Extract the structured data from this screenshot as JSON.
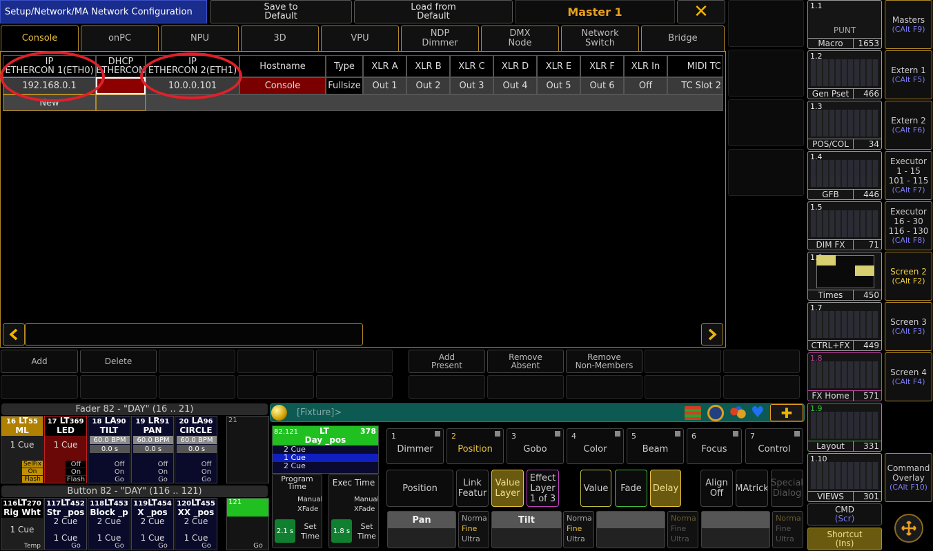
{
  "title": "Setup/Network/MA Network Configuration",
  "top": {
    "save": "Save to\nDefault",
    "load": "Load from\nDefault",
    "master": "Master 1",
    "close": "✕"
  },
  "tabs": [
    "Console",
    "onPC",
    "NPU",
    "3D",
    "VPU",
    "NDP\nDimmer",
    "DMX\nNode",
    "Network\nSwitch",
    "Bridge"
  ],
  "table": {
    "headers": [
      "IP\nETHERCON 1(ETH0)",
      "DHCP\nETHERCON",
      "IP\nETHERCON 2(ETH1)",
      "Hostname",
      "Type",
      "XLR A",
      "XLR B",
      "XLR C",
      "XLR D",
      "XLR E",
      "XLR F",
      "XLR In",
      "MIDI TC"
    ],
    "row": [
      "192.168.0.1",
      "",
      "10.0.0.101",
      "Console",
      "Fullsize",
      "Out 1",
      "Out 2",
      "Out 3",
      "Out 4",
      "Out 5",
      "Out 6",
      "Off",
      "TC Slot 2"
    ],
    "new_label": "New"
  },
  "actions": {
    "add": "Add",
    "delete": "Delete",
    "add_present": "Add\nPresent",
    "remove_absent": "Remove\nAbsent",
    "remove_non_members": "Remove\nNon-Members"
  },
  "views": [
    {
      "num": "1.1",
      "name": "Macro",
      "count": "1653",
      "label": "PUNT"
    },
    {
      "num": "1.2",
      "name": "Gen Pset",
      "count": "466"
    },
    {
      "num": "1.3",
      "name": "POS/COL",
      "count": "34"
    },
    {
      "num": "1.4",
      "name": "GFB",
      "count": "446"
    },
    {
      "num": "1.5",
      "name": "DIM FX",
      "count": "71"
    },
    {
      "num": "1.6",
      "name": "Times",
      "count": "450"
    },
    {
      "num": "1.7",
      "name": "CTRL+FX",
      "count": "449"
    },
    {
      "num": "1.8",
      "name": "FX Home",
      "count": "571"
    },
    {
      "num": "1.9",
      "name": "Layout",
      "count": "331"
    },
    {
      "num": "1.10",
      "name": "VIEWS",
      "count": "301"
    }
  ],
  "side": [
    {
      "label": "Masters",
      "key": "(CAlt F9)"
    },
    {
      "label": "Extern 1",
      "key": "(CAlt F5)"
    },
    {
      "label": "Extern 2",
      "key": "(CAlt F6)"
    },
    {
      "label": "Executor\n1 - 15\n101 - 115",
      "key": "(CAlt F7)"
    },
    {
      "label": "Executor\n16 - 30\n116 - 130",
      "key": "(CAlt F8)"
    },
    {
      "label": "Screen 2",
      "key": "(CAlt F2)"
    },
    {
      "label": "Screen 3",
      "key": "(CAlt F3)"
    },
    {
      "label": "Screen 4",
      "key": "(CAlt F4)"
    }
  ],
  "cmd": {
    "label": "CMD",
    "key": "(Scr)"
  },
  "shortcut": {
    "label": "Shortcut",
    "key": "(Ins)"
  },
  "command_overlay": {
    "label": "Command\nOverlay",
    "key": "(CAlt F10)"
  },
  "fader_title": "Fader  82  - \"DAY\" (16 .. 21)",
  "button_title": "Button  82  - \"DAY\" (116 .. 121)",
  "faders": [
    {
      "num": "16",
      "type": "LT",
      "id": "55",
      "name": "ML",
      "cue": "1 Cue",
      "bottom": [
        "SelFix",
        "On",
        "Flash"
      ]
    },
    {
      "num": "17",
      "type": "LT",
      "id": "369",
      "name": "LED",
      "cue": "1 Cue",
      "bottom": [
        "Off",
        "On",
        "Flash"
      ]
    },
    {
      "num": "18",
      "type": "LA",
      "id": "90",
      "name": "TILT",
      "bpm": "60.0 BPM",
      "sec": "0.0 s",
      "bottom": [
        "Off",
        "On",
        "Go"
      ]
    },
    {
      "num": "19",
      "type": "LR",
      "id": "91",
      "name": "PAN",
      "bpm": "60.0 BPM",
      "sec": "0.0 s",
      "bottom": [
        "Off",
        "On",
        "Go"
      ]
    },
    {
      "num": "20",
      "type": "LA",
      "id": "96",
      "name": "CIRCLE",
      "bpm": "60.0 BPM",
      "sec": "0.0 s",
      "bottom": [
        "Off",
        "On",
        "Go"
      ]
    },
    {
      "num": "21"
    }
  ],
  "buttons": [
    {
      "num": "116",
      "type": "LT",
      "id": "270",
      "name": "Rig Wht",
      "cue": "1 Cue",
      "foot": "Temp"
    },
    {
      "num": "117",
      "type": "LT",
      "id": "452",
      "name": "Str _pos",
      "cue": "2 Cue",
      "cue2": "1 Cue",
      "foot": "Go"
    },
    {
      "num": "118",
      "type": "LT",
      "id": "453",
      "name": "Block _p",
      "cue": "2 Cue",
      "cue2": "1 Cue",
      "foot": "Go"
    },
    {
      "num": "119",
      "type": "LT",
      "id": "454",
      "name": "X _pos",
      "cue": "2 Cue",
      "cue2": "1 Cue",
      "foot": "Go"
    },
    {
      "num": "120",
      "type": "LT",
      "id": "455",
      "name": "XX _pos",
      "cue": "2 Cue",
      "cue2": "1 Cue",
      "foot": "Go"
    },
    {
      "num": "121",
      "foot": "Go"
    }
  ],
  "cmdline": {
    "text": "[Fixture]>",
    "plus": "✚"
  },
  "exec_box": {
    "num": "82.121",
    "type": "LT",
    "id": "378",
    "name": "Day _pos",
    "cues": [
      "2 Cue",
      "1 Cue",
      "2 Cue"
    ]
  },
  "prog_time": {
    "label": "Program\nTime",
    "manual": "Manual\nXFade",
    "value": "2.1 s",
    "set": "Set\nTime"
  },
  "exec_time": {
    "label": "Exec Time",
    "manual": "Manual\nXFade",
    "value": "1.8 s",
    "set": "Set\nTime"
  },
  "features": [
    {
      "n": "1",
      "label": "Dimmer"
    },
    {
      "n": "2",
      "label": "Position"
    },
    {
      "n": "3",
      "label": "Gobo"
    },
    {
      "n": "4",
      "label": "Color"
    },
    {
      "n": "5",
      "label": "Beam"
    },
    {
      "n": "6",
      "label": "Focus"
    },
    {
      "n": "7",
      "label": "Control"
    }
  ],
  "subs": {
    "position": "Position",
    "link": "Link\nFeatur",
    "value_layer": "Value\nLayer",
    "effect_layer": "Effect\nLayer\n1 of 3",
    "value": "Value",
    "fade": "Fade",
    "delay": "Delay",
    "align": "Align\nOff",
    "matricks": "MAtrick",
    "special": "Special\nDialog"
  },
  "encoders": {
    "pan": "Pan",
    "tilt": "Tilt",
    "mode": [
      "Norma",
      "Fine",
      "Ultra"
    ]
  },
  "colors": {
    "accent": "#e8c040",
    "title_bar": "#1a2c8c",
    "highlight_red": "#e0202a",
    "hostname_bg": "#7a0000"
  }
}
